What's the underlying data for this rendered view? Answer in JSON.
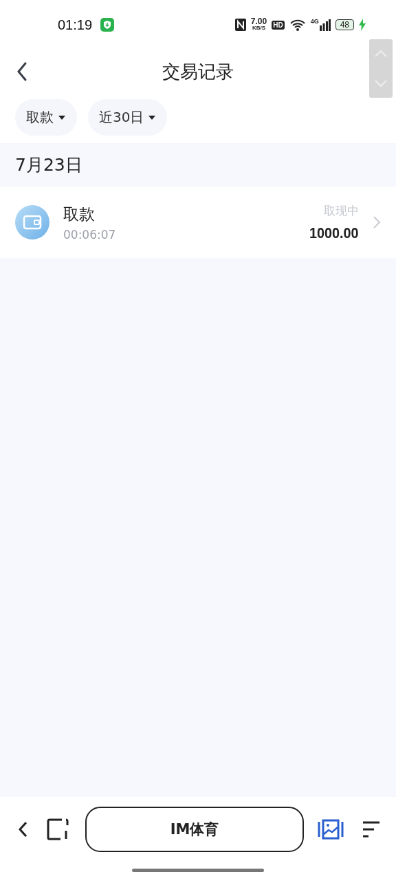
{
  "status_bar": {
    "time": "01:19",
    "speed": "7.00",
    "speed_unit": "KB/S",
    "hd": "HD",
    "network": "4G",
    "battery": "48",
    "charging": true
  },
  "header": {
    "title": "交易记录"
  },
  "filters": [
    {
      "label": "取款"
    },
    {
      "label": "近30日"
    }
  ],
  "groups": [
    {
      "date": "7月23日",
      "transactions": [
        {
          "title": "取款",
          "time": "00:06:07",
          "status": "取现中",
          "amount": "1000.00"
        }
      ]
    }
  ],
  "browser_bar": {
    "site": "IM体育"
  }
}
